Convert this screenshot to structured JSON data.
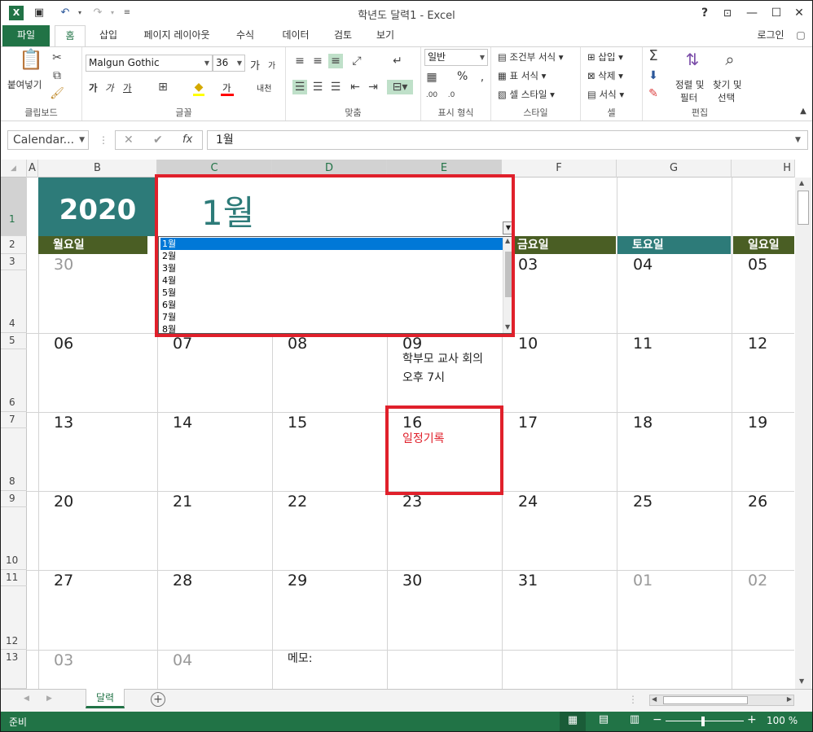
{
  "window": {
    "title": "학년도 달력1 - Excel",
    "help": "?",
    "login": "로그인"
  },
  "tabs": [
    "파일",
    "홈",
    "삽입",
    "페이지 레이아웃",
    "수식",
    "데이터",
    "검토",
    "보기"
  ],
  "ribbon": {
    "clipboard": {
      "paste": "붙여넣기",
      "label": "클립보드"
    },
    "font": {
      "name": "Malgun Gothic",
      "size": "36",
      "grow": "가",
      "shrink": "가",
      "bold": "가",
      "italic": "가",
      "underline": "가",
      "color_a": "가",
      "label": "글꼴",
      "phonetic": "내천"
    },
    "align": {
      "label": "맞춤"
    },
    "number": {
      "format": "일반",
      "percent": "%",
      "label": "표시 형식"
    },
    "styles": {
      "cond": "조건부 서식",
      "table": "표 서식",
      "cell": "셀 스타일",
      "label": "스타일"
    },
    "cells": {
      "insert": "삽입",
      "delete": "삭제",
      "format": "서식",
      "label": "셀"
    },
    "editing": {
      "sort": "정렬 및",
      "filter": "필터",
      "find": "찾기 및",
      "select": "선택",
      "label": "편집"
    }
  },
  "formula_bar": {
    "name_box": "Calendar...",
    "value": "1월",
    "fx": "fx",
    "cancel": "✕",
    "enter": "✔"
  },
  "columns": [
    "A",
    "B",
    "C",
    "D",
    "E",
    "F",
    "G",
    "H"
  ],
  "rows": [
    "1",
    "2",
    "3",
    "4",
    "5",
    "6",
    "7",
    "8",
    "9",
    "10",
    "11",
    "12",
    "13"
  ],
  "calendar": {
    "year": "2020",
    "month": "1월",
    "weekdays": {
      "mon": "월요일",
      "fri": "금요일",
      "sat": "토요일",
      "sun": "일요일"
    },
    "week1": [
      "30",
      "03",
      "04",
      "05"
    ],
    "week2": [
      "06",
      "07",
      "08",
      "09",
      "10",
      "11",
      "12"
    ],
    "week3": [
      "13",
      "14",
      "15",
      "16",
      "17",
      "18",
      "19"
    ],
    "week4": [
      "20",
      "21",
      "22",
      "23",
      "24",
      "25",
      "26"
    ],
    "week5": [
      "27",
      "28",
      "29",
      "30",
      "31",
      "01",
      "02"
    ],
    "week6": [
      "03",
      "04"
    ],
    "event1": [
      "학부모 교사 회의",
      "오후 7시"
    ],
    "event2": "일정기록",
    "memo": "메모:"
  },
  "dropdown": [
    "1월",
    "2월",
    "3월",
    "4월",
    "5월",
    "6월",
    "7월",
    "8월"
  ],
  "sheet": {
    "tab": "달력"
  },
  "status": {
    "ready": "준비",
    "zoom": "100 %"
  },
  "colors": {
    "teal": "#2d7b79",
    "olive": "#4a5e24",
    "excel_green": "#217346",
    "red": "#e0202b"
  }
}
